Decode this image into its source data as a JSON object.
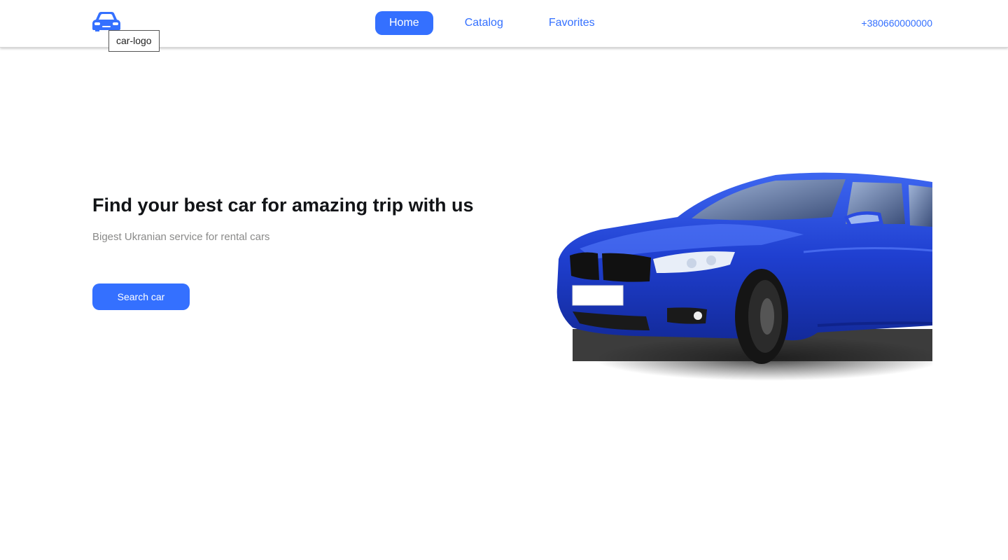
{
  "header": {
    "logo_tooltip": "car-logo",
    "nav": [
      {
        "label": "Home",
        "active": true
      },
      {
        "label": "Catalog",
        "active": false
      },
      {
        "label": "Favorites",
        "active": false
      }
    ],
    "phone": "+380660000000"
  },
  "hero": {
    "title": "Find your best car for amazing trip with us",
    "subtitle": "Bigest Ukranian service for rental cars",
    "button_label": "Search car"
  },
  "colors": {
    "accent": "#3470ff",
    "title": "#121417",
    "subtitle": "#8a8a89",
    "car_body": "#2448d8"
  },
  "icons": {
    "logo": "car-front-icon"
  }
}
